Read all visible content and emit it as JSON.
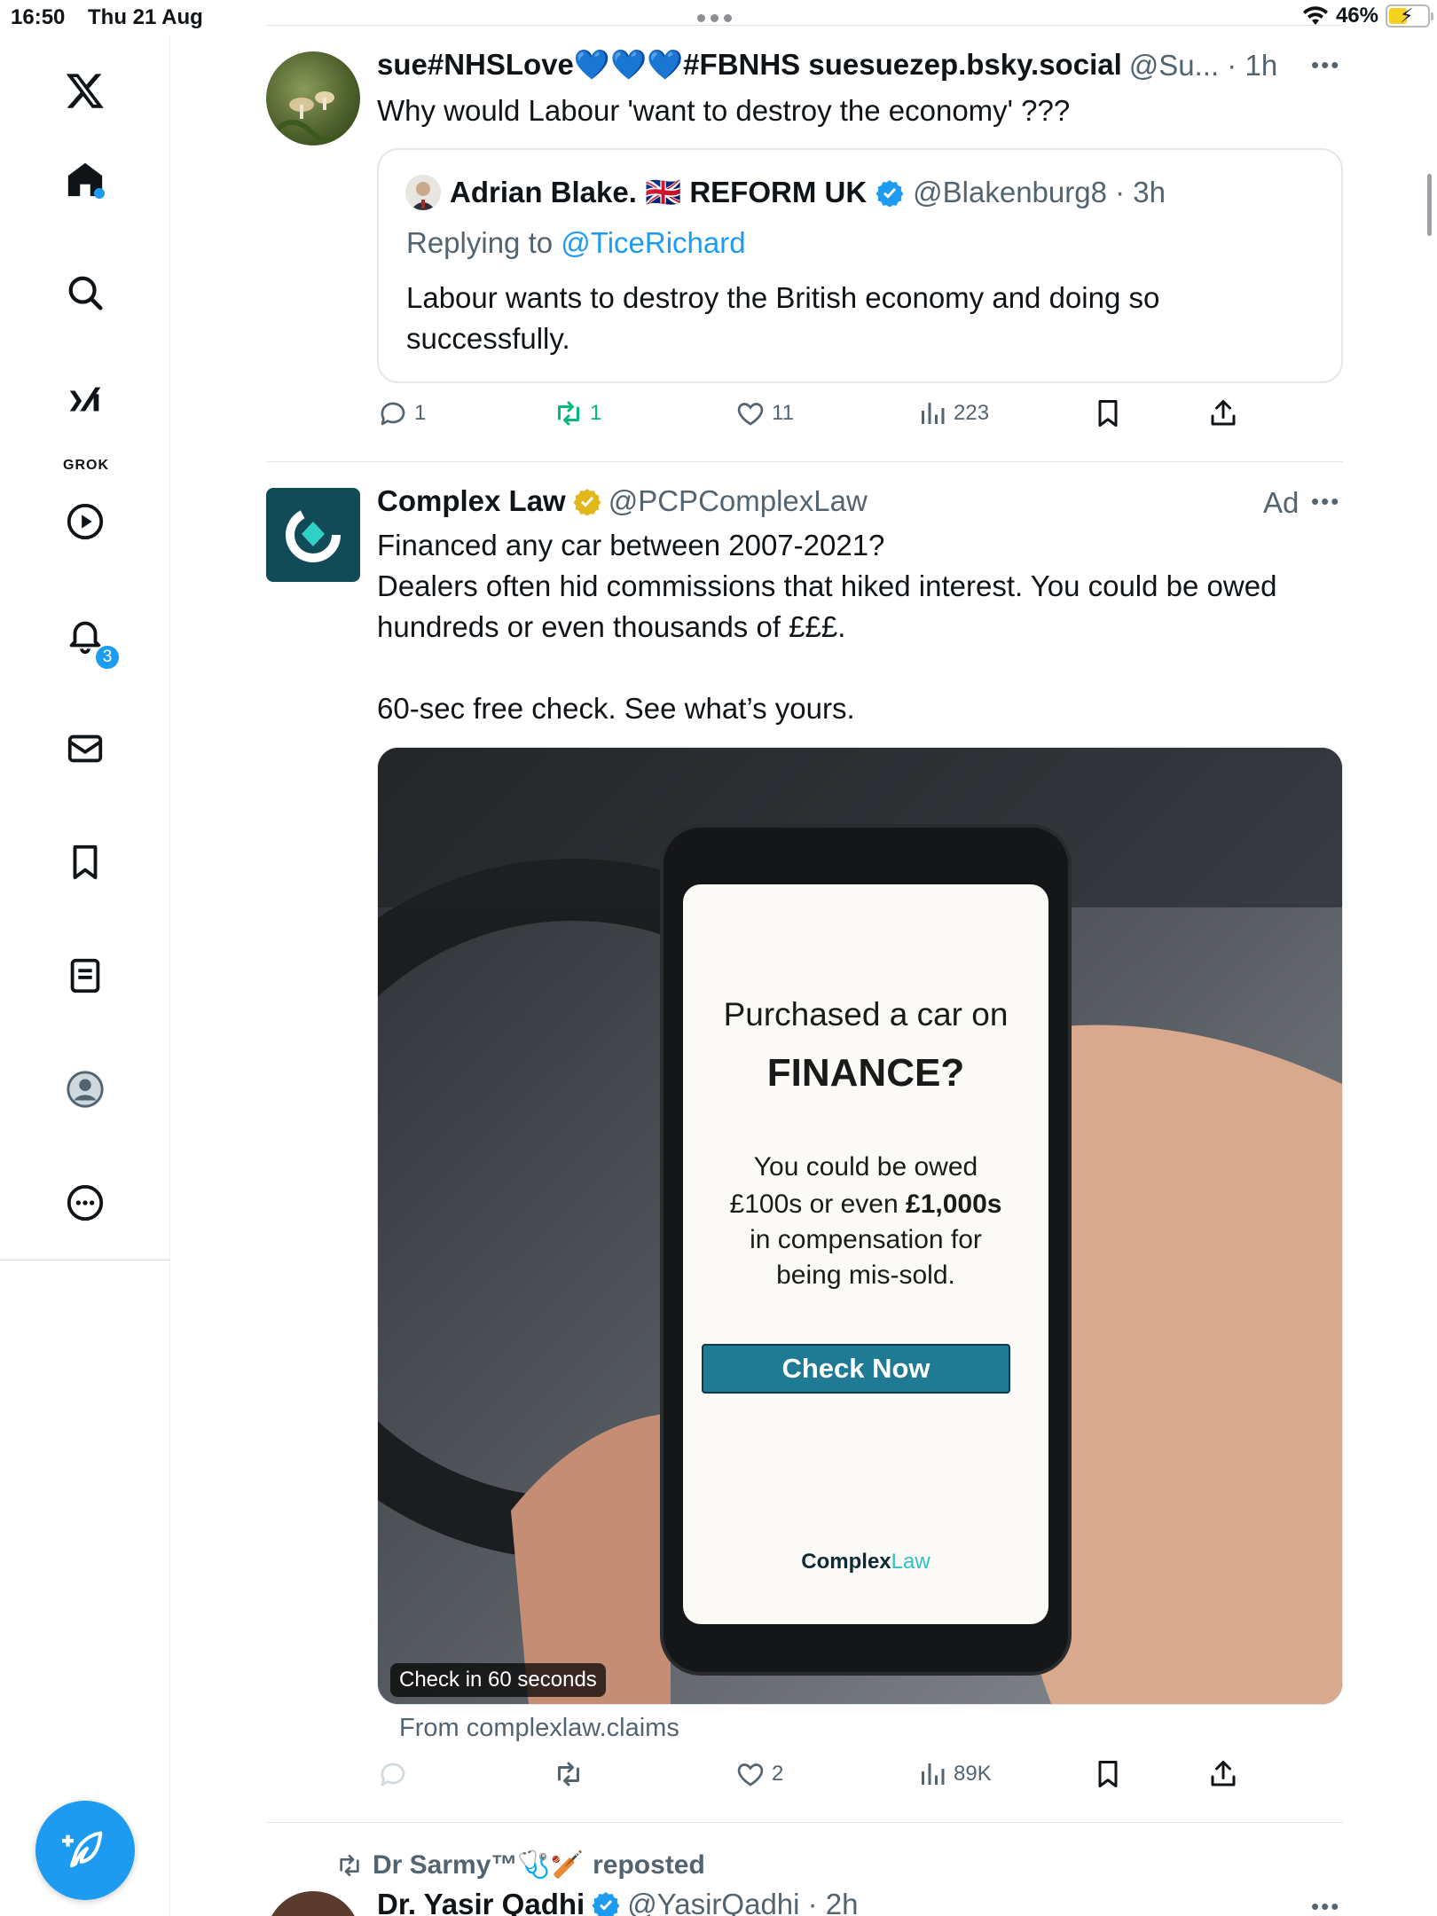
{
  "status_bar": {
    "time": "16:50",
    "date": "Thu 21 Aug",
    "battery": "46%"
  },
  "sidebar": {
    "items": [
      {
        "name": "x-logo-icon"
      },
      {
        "name": "home-icon"
      },
      {
        "name": "search-icon"
      },
      {
        "name": "grok-icon",
        "label": "GROK"
      },
      {
        "name": "video-icon"
      },
      {
        "name": "notifications-icon",
        "badge": "3"
      },
      {
        "name": "messages-icon"
      },
      {
        "name": "bookmarks-icon"
      },
      {
        "name": "lists-icon"
      },
      {
        "name": "profile-icon"
      },
      {
        "name": "more-icon"
      }
    ],
    "compose": "compose-icon"
  },
  "posts": [
    {
      "name": "sue#NHSLove💙💙💙#FBNHS suesuezep.bsky.social",
      "handle_time": "@Su... · 1h",
      "text": "Why would Labour 'want to destroy the economy' ???",
      "quote": {
        "name": "Adrian Blake. 🇬🇧 REFORM UK",
        "handle_time": "@Blakenburg8 · 3h",
        "replying_prefix": "Replying to ",
        "replying_to": "@TiceRichard",
        "text": "Labour wants to destroy the British economy and doing so successfully."
      },
      "actions": {
        "replies": "1",
        "reposts": "1",
        "likes": "11",
        "views": "223"
      }
    },
    {
      "name": "Complex Law",
      "handle": "@PCPComplexLaw",
      "ad_label": "Ad",
      "text_line1": "Financed any car between 2007-2021?",
      "text_line2": "Dealers often hid commissions that hiked interest. You could be owed hundreds or even thousands of £££.",
      "text_line3": "60-sec free check. See what’s yours.",
      "media": {
        "screen_line1": "Purchased a car on",
        "screen_line2": "FINANCE?",
        "screen_line3": "You could be owed",
        "screen_line4a": "£100s or even ",
        "screen_line4b": "£1,000s",
        "screen_line5": "in compensation for",
        "screen_line6": "being mis-sold.",
        "button": "Check Now",
        "brand": "Complex",
        "brand_suffix": "Law",
        "caption": "Check in 60 seconds"
      },
      "from": "From complexlaw.claims",
      "actions": {
        "replies": "",
        "reposts": "",
        "likes": "2",
        "views": "89K"
      }
    },
    {
      "repost_by": "Dr Sarmy™🩺🏏",
      "repost_suffix": "reposted",
      "name": "Dr. Yasir Qadhi",
      "handle_time": "@YasirQadhi · 2h"
    }
  ],
  "colors": {
    "accent": "#1d9bf0",
    "text": "#0f1419",
    "muted": "#536471",
    "repost_green": "#00ba7c",
    "cta_button": "#1f7a94"
  }
}
